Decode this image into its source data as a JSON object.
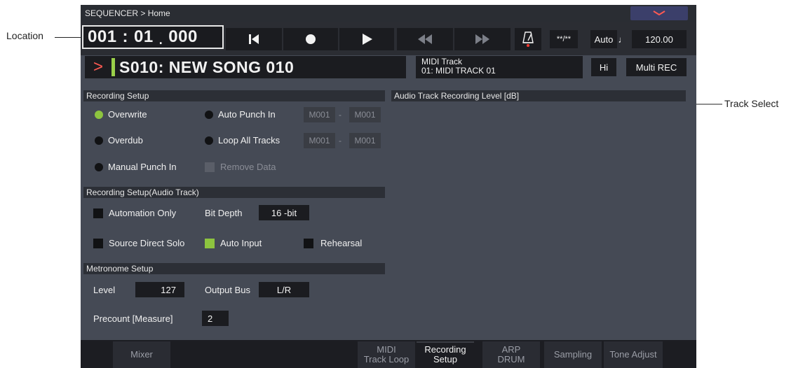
{
  "annotations": {
    "location": "Location",
    "track_select": "Track Select"
  },
  "header": {
    "breadcrumb": "SEQUENCER > Home"
  },
  "transport": {
    "location": {
      "measure": "001",
      "beat": "01",
      "tick": "000"
    },
    "buttons": [
      "reset-to-start",
      "record",
      "play",
      "rewind",
      "fast-forward"
    ],
    "metronome_icon": "metronome-icon",
    "time_signature": "**/**",
    "tempo_mode": "Auto",
    "tempo_note": "♩",
    "tempo": "120.00"
  },
  "song": {
    "chevron": ">",
    "title": "S010: NEW SONG 010"
  },
  "track": {
    "line1": "MIDI Track",
    "line2": "01: MIDI TRACK 01"
  },
  "hi_button": "Hi",
  "multi_rec_button": "Multi REC",
  "recording_setup": {
    "header": "Recording Setup",
    "overwrite": "Overwrite",
    "overdub": "Overdub",
    "manual_punch_in": "Manual Punch In",
    "auto_punch_in": "Auto Punch In",
    "loop_all_tracks": "Loop All Tracks",
    "remove_data": "Remove Data",
    "auto_punch_from": "M001",
    "auto_punch_to": "M001",
    "loop_from": "M001",
    "loop_to": "M001",
    "range_sep": "-",
    "selected_mode": "Overwrite"
  },
  "audio_level": {
    "header": "Audio Track Recording Level [dB]"
  },
  "recording_setup_audio": {
    "header": "Recording Setup(Audio Track)",
    "automation_only": "Automation Only",
    "bit_depth_label": "Bit Depth",
    "bit_depth": "16 -bit",
    "source_direct_solo": "Source Direct Solo",
    "auto_input": "Auto Input",
    "auto_input_checked": true,
    "rehearsal": "Rehearsal"
  },
  "metronome": {
    "header": "Metronome Setup",
    "level_label": "Level",
    "level": "127",
    "output_bus_label": "Output Bus",
    "output_bus": "L/R",
    "precount_label": "Precount [Measure]",
    "precount": "2"
  },
  "tabs": [
    {
      "line1": "Mixer",
      "line2": ""
    },
    {
      "line1": "MIDI",
      "line2": "Track Loop"
    },
    {
      "line1": "Recording",
      "line2": "Setup"
    },
    {
      "line1": "ARP",
      "line2": "DRUM"
    },
    {
      "line1": "Sampling",
      "line2": ""
    },
    {
      "line1": "Tone Adjust",
      "line2": ""
    }
  ],
  "active_tab": "Recording Setup",
  "colors": {
    "accent_green": "#8dc43f",
    "chevron_red": "#ff5a52",
    "panel": "#454a55",
    "dark": "#1b1c20"
  }
}
